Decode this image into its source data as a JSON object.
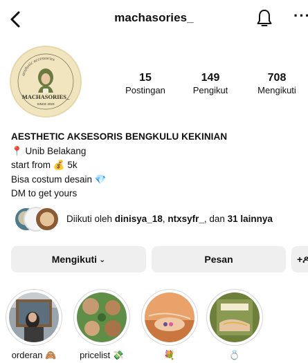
{
  "header": {
    "username": "machasories_",
    "back_icon": "chevron-left-icon",
    "notification_icon": "bell-icon",
    "more_icon": "ellipsis-icon",
    "more_label": "···"
  },
  "profile": {
    "avatar_logo_text": "aesthetic accessories",
    "avatar_brand": "MACHASORIES_",
    "avatar_since": "SINCE 2023",
    "stats": [
      {
        "value": "15",
        "label": "Postingan"
      },
      {
        "value": "149",
        "label": "Pengikut"
      },
      {
        "value": "708",
        "label": "Mengikuti"
      }
    ]
  },
  "bio": {
    "name": "AESTHETIC AKSESORIS  BENGKULU KEKINIAN",
    "lines": [
      "📍 Unib Belakang",
      "start from 💰 5k",
      "Bisa costum desain 💎",
      "DM to get yours"
    ]
  },
  "followed_by": {
    "prefix": "Diikuti oleh ",
    "user1": "dinisya_18",
    "separator": ", ",
    "user2": "ntxsyfr_",
    "middle": ", dan ",
    "others": "31 lainnya"
  },
  "actions": {
    "follow_label": "Mengikuti",
    "follow_chevron": "⌄",
    "message_label": "Pesan",
    "add_label": "+ዶ"
  },
  "highlights": [
    {
      "label": "orderan 🙈"
    },
    {
      "label": "pricelist 💸"
    },
    {
      "label": "💐"
    },
    {
      "label": "💍"
    }
  ]
}
